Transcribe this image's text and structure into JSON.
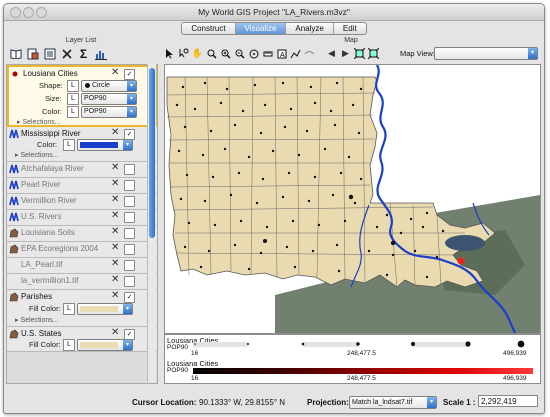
{
  "window": {
    "title": "My World GIS Project \"LA_Rivers.m3vz\""
  },
  "tabs": [
    {
      "label": "Construct",
      "active": false
    },
    {
      "label": "Visualize",
      "active": true
    },
    {
      "label": "Analyze",
      "active": false
    },
    {
      "label": "Edit",
      "active": false
    }
  ],
  "layer_list": {
    "header": "Layer List",
    "layers": [
      {
        "name": "Lousiana Cities",
        "shape_label": "Shape:",
        "shape_value": "Circle",
        "size_label": "Size:",
        "size_value": "POP90",
        "color_label": "Color:",
        "color_value": "POP90",
        "selections": "Selections..."
      },
      {
        "name": "Mississippi  River",
        "color_label": "Color:",
        "color": "#1a3fc8",
        "selections": "Selections..."
      },
      {
        "name": "Atchafalaya River"
      },
      {
        "name": "Pearl River"
      },
      {
        "name": "Vermillion River"
      },
      {
        "name": "U.S. Rivers"
      },
      {
        "name": "Louisiana Soils"
      },
      {
        "name": "EPA Ecoregions 2004"
      },
      {
        "name": "LA_Pearl.tif"
      },
      {
        "name": "la_vermillion1.tif"
      },
      {
        "name": "Parishes",
        "fill_label": "Fill Color:",
        "fill_color": "#ebdcb4",
        "selections": "Selections..."
      },
      {
        "name": "U.S. States",
        "fill_label": "Fill Color:",
        "fill_color": "#ebdcb4"
      }
    ],
    "shape_letter": "L"
  },
  "map": {
    "header": "Map",
    "view_label": "Map View:",
    "view_value": "",
    "colors": {
      "land": "#eadab0",
      "water_blue": "#1a3fc8",
      "imagery": "#7a8a7a"
    }
  },
  "legend": {
    "size": {
      "title": "Lousiana Cities",
      "field": "POP90",
      "min": "16",
      "mid": "248,477.5",
      "max": "496,939"
    },
    "color": {
      "title": "Lousiana Cities",
      "field": "POP90",
      "min": "16",
      "mid": "248,477.5",
      "max": "496,939"
    }
  },
  "status": {
    "cursor_label": "Cursor Location:",
    "cursor_value": "90.1333° W, 29.8155° N",
    "projection_label": "Projection:",
    "projection_value": "Match la_lndsat7.tif",
    "scale_label": "Scale 1 :",
    "scale_value": "2,292,419"
  }
}
